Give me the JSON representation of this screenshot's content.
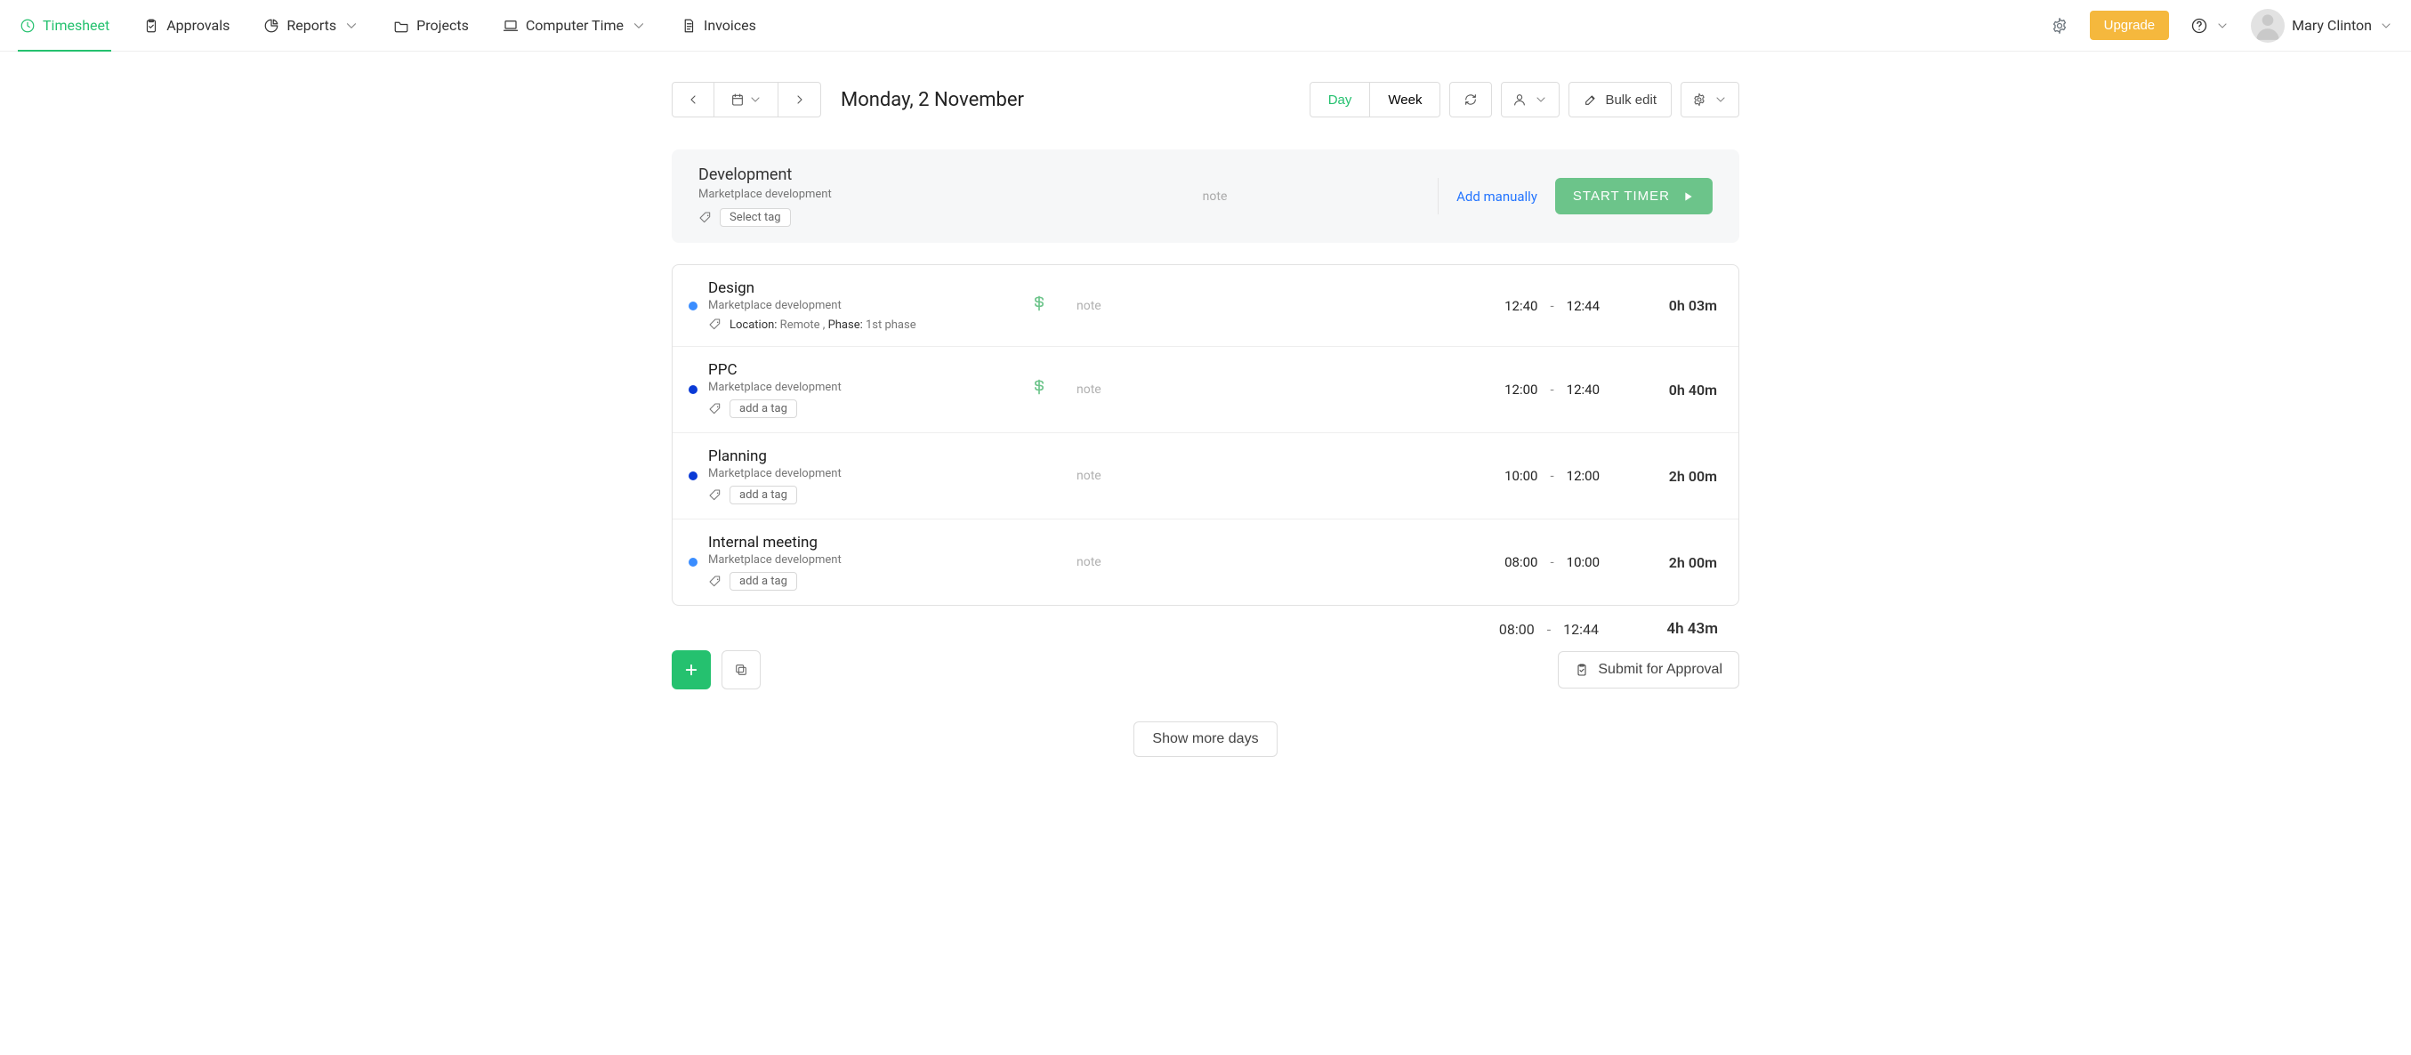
{
  "nav": {
    "timesheet": "Timesheet",
    "approvals": "Approvals",
    "reports": "Reports",
    "projects": "Projects",
    "computer_time": "Computer Time",
    "invoices": "Invoices"
  },
  "header": {
    "upgrade": "Upgrade",
    "user_name": "Mary Clinton"
  },
  "toolbar": {
    "date_label": "Monday, 2 November",
    "view_day": "Day",
    "view_week": "Week",
    "bulk_edit": "Bulk edit"
  },
  "entry_panel": {
    "task": "Development",
    "project": "Marketplace development",
    "select_tag": "Select tag",
    "note_placeholder": "note",
    "add_manually": "Add manually",
    "start_timer": "START TIMER"
  },
  "entries": [
    {
      "dot": "lblue",
      "task": "Design",
      "project": "Marketplace development",
      "tags_text": "Location: Remote , Phase: 1st phase",
      "tag_button": "",
      "billable": true,
      "note": "note",
      "start": "12:40",
      "end": "12:44",
      "duration": "0h 03m"
    },
    {
      "dot": "blue",
      "task": "PPC",
      "project": "Marketplace development",
      "tags_text": "",
      "tag_button": "add a tag",
      "billable": true,
      "note": "note",
      "start": "12:00",
      "end": "12:40",
      "duration": "0h 40m"
    },
    {
      "dot": "blue",
      "task": "Planning",
      "project": "Marketplace development",
      "tags_text": "",
      "tag_button": "add a tag",
      "billable": false,
      "note": "note",
      "start": "10:00",
      "end": "12:00",
      "duration": "2h 00m"
    },
    {
      "dot": "lblue",
      "task": "Internal meeting",
      "project": "Marketplace development",
      "tags_text": "",
      "tag_button": "add a tag",
      "billable": false,
      "note": "note",
      "start": "08:00",
      "end": "10:00",
      "duration": "2h 00m"
    }
  ],
  "summary": {
    "start": "08:00",
    "end": "12:44",
    "duration": "4h 43m"
  },
  "bottom": {
    "submit": "Submit for Approval",
    "show_more": "Show more days"
  }
}
